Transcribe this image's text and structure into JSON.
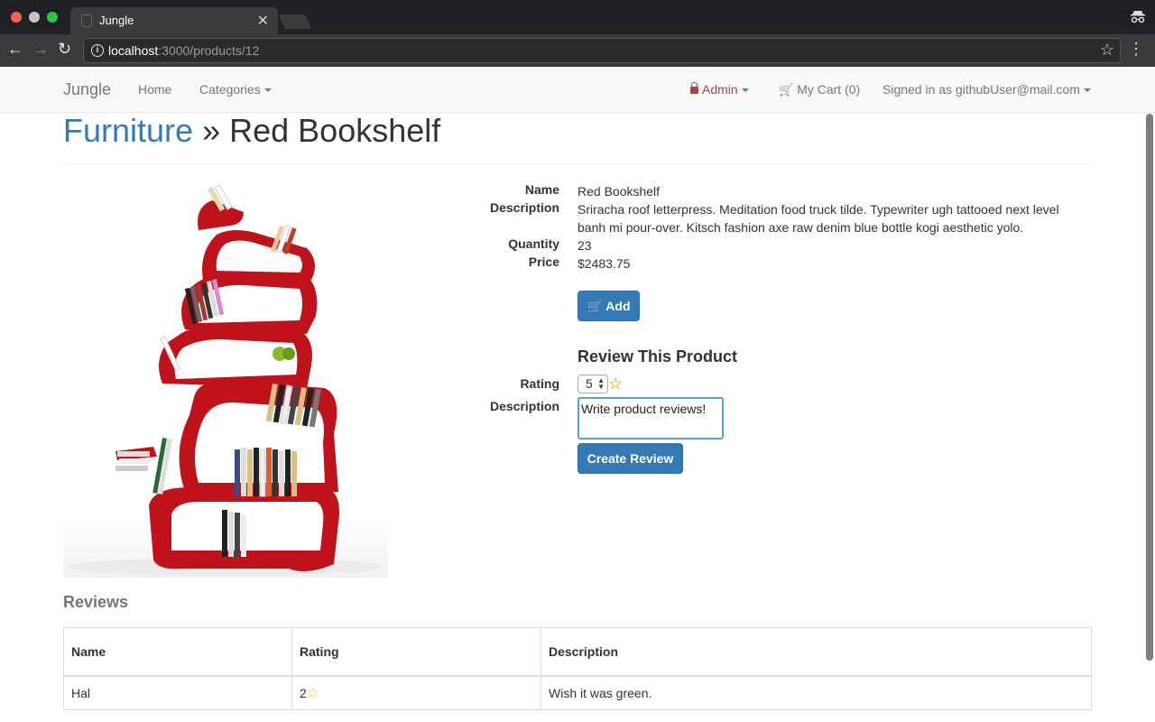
{
  "browser": {
    "tab_title": "Jungle",
    "url_host": "localhost",
    "url_path": ":3000/products/12"
  },
  "nav": {
    "brand": "Jungle",
    "home": "Home",
    "categories": "Categories",
    "admin": "Admin",
    "cart": "My Cart (0)",
    "signed_in": "Signed in as githubUser@mail.com"
  },
  "page": {
    "category": "Furniture",
    "separator": "»",
    "product_title": "Red Bookshelf"
  },
  "product": {
    "name_label": "Name",
    "name": "Red Bookshelf",
    "description_label": "Description",
    "description": "Sriracha roof letterpress. Meditation food truck tilde. Typewriter ugh tattooed next level banh mi pour-over. Kitsch fashion axe raw denim blue bottle kogi aesthetic yolo.",
    "quantity_label": "Quantity",
    "quantity": "23",
    "price_label": "Price",
    "price": "$2483.75",
    "add_label": "Add"
  },
  "review_form": {
    "title": "Review This Product",
    "rating_label": "Rating",
    "rating_value": "5",
    "description_label": "Description",
    "description_value": "Write product reviews!",
    "submit_label": "Create Review"
  },
  "reviews": {
    "title": "Reviews",
    "columns": [
      "Name",
      "Rating",
      "Description"
    ],
    "rows": [
      {
        "name": "Hal",
        "rating": "2",
        "description": "Wish it was green."
      }
    ]
  },
  "colors": {
    "primary": "#337ab7",
    "admin": "#a94442",
    "bookshelf_red": "#c0121b",
    "star": "#f2c31c"
  }
}
